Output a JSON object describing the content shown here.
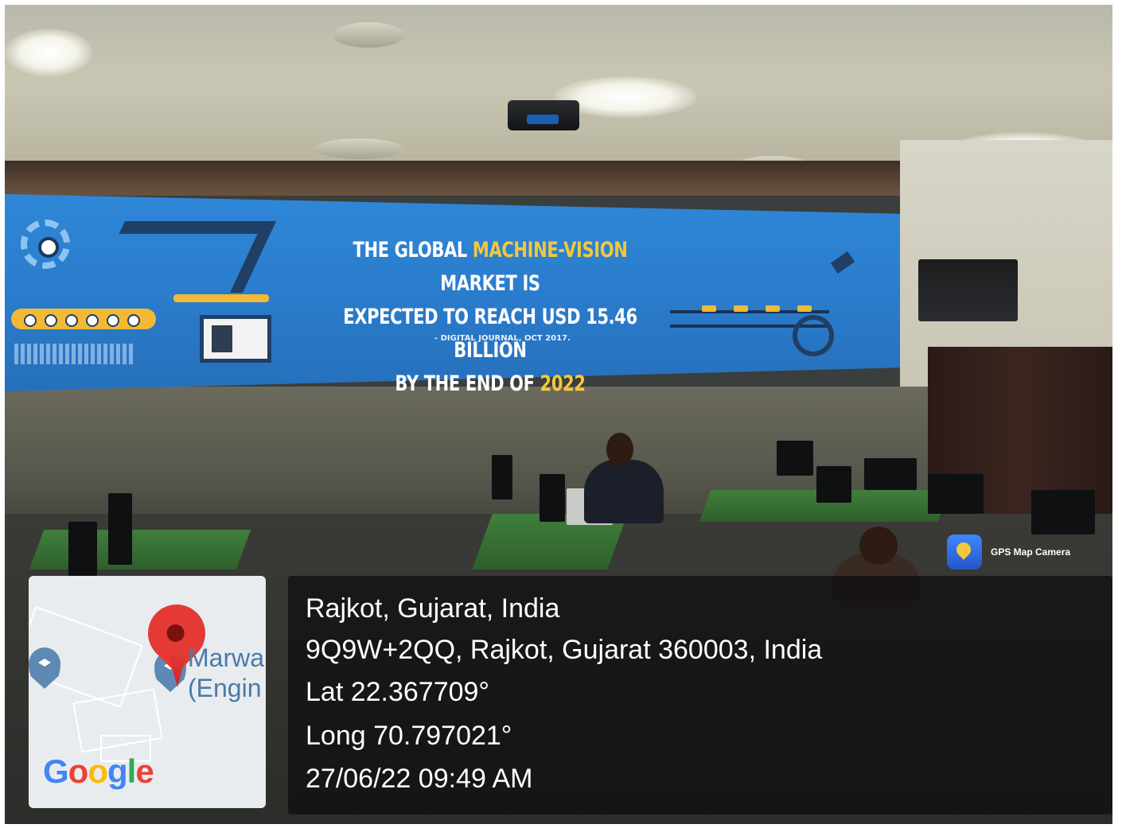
{
  "banner": {
    "line1_pre": "THE GLOBAL ",
    "line1_highlight": "MACHINE-VISION",
    "line1_post": " MARKET IS",
    "line2": "EXPECTED TO REACH USD 15.46 BILLION",
    "line3_pre": "BY THE END OF ",
    "line3_highlight": "2022",
    "source": "- DIGITAL JOURNAL, OCT 2017.",
    "highlight_color": "#f5c73a",
    "background_color": "#2f87d7"
  },
  "map": {
    "place_label_line1": "Marwa",
    "place_label_line2": "(Engin",
    "logo_letters": [
      "G",
      "o",
      "o",
      "g",
      "l",
      "e"
    ],
    "pin_icon": "map-pin-icon",
    "education_icon": "graduation-cap-icon"
  },
  "location": {
    "title": "Rajkot, Gujarat, India",
    "address": "9Q9W+2QQ, Rajkot, Gujarat 360003, India",
    "latitude": "Lat 22.367709°",
    "longitude": "Long 70.797021°",
    "datetime": "27/06/22 09:49 AM"
  },
  "app": {
    "name": "GPS Map Camera",
    "icon": "gps-map-camera-icon"
  }
}
